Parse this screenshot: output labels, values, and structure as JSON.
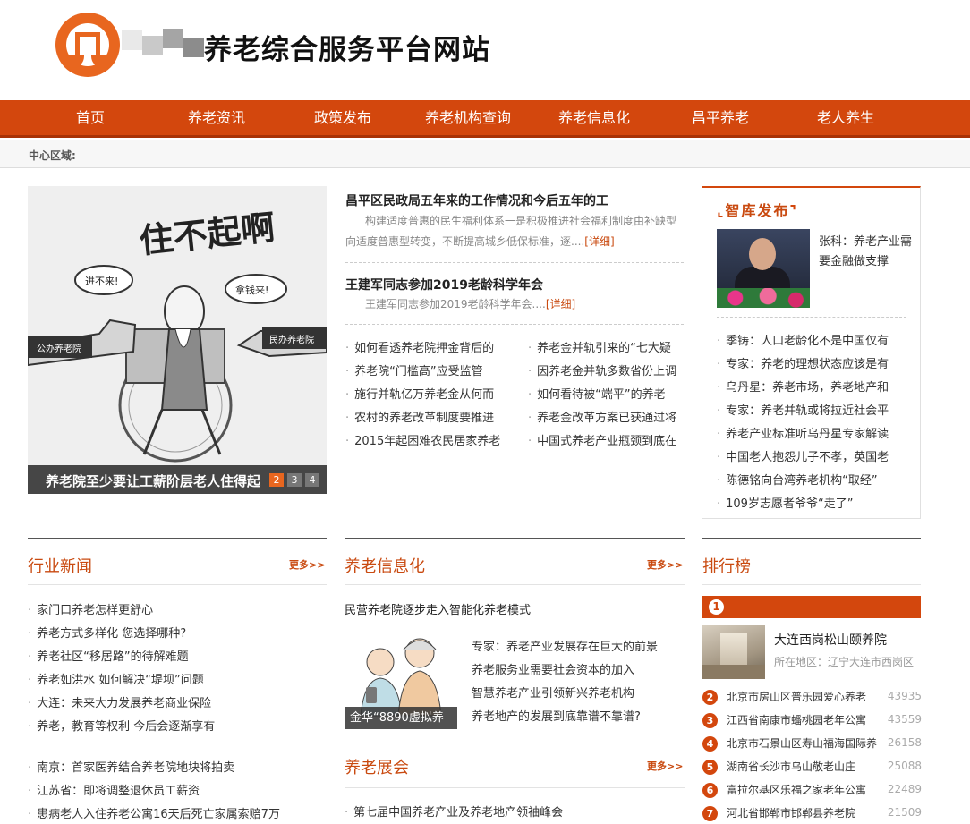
{
  "header": {
    "site_title": "养老综合服务平台网站"
  },
  "nav": [
    {
      "label": "首页"
    },
    {
      "label": "养老资讯"
    },
    {
      "label": "政策发布"
    },
    {
      "label": "养老机构查询"
    },
    {
      "label": "养老信息化"
    },
    {
      "label": "昌平养老"
    },
    {
      "label": "老人养生"
    }
  ],
  "center_label": "中心区域:",
  "slider": {
    "caption": "养老院至少要让工薪阶层老人住得起",
    "pages": [
      "2",
      "3",
      "4"
    ],
    "cartoon": {
      "title": "住不起啊",
      "left_bubble": "进不来!",
      "right_bubble": "拿钱来!",
      "left_sign": "公办养老院",
      "right_sign": "民办养老院"
    }
  },
  "top_news": [
    {
      "title": "昌平区民政局五年来的工作情况和今后五年的工",
      "summary": "构建适度普惠的民生福利体系一是积极推进社会福利制度由补缺型向适度普惠型转变，不断提高城乡低保标准，逐....",
      "more": "[详细]"
    },
    {
      "title": "王建军同志参加2019老龄科学年会",
      "summary": "王建军同志参加2019老龄科学年会....",
      "more": "[详细]"
    }
  ],
  "news_list_left": [
    "如何看透养老院押金背后的",
    "养老院“门槛高”应受监管",
    "施行并轨亿万养老金从何而",
    "农村的养老改革制度要推进",
    "2015年起困难农民居家养老"
  ],
  "news_list_right": [
    "养老金并轨引来的“七大疑",
    "因养老金并轨多数省份上调",
    "如何看待被“端平”的养老",
    "养老金改革方案已获通过将",
    "中国式养老产业瓶颈到底在"
  ],
  "think_tank": {
    "title": "智库发布",
    "feature": "张科：养老产业需要金融做支撑",
    "items": [
      "季铸：人口老龄化不是中国仅有",
      "专家：养老的理想状态应该是有",
      "乌丹星：养老市场，养老地产和",
      "专家：养老并轨或将拉近社会平",
      "养老产业标准听乌丹星专家解读",
      "中国老人抱怨儿子不孝，英国老",
      "陈德铭向台湾养老机构“取经”",
      "109岁志愿者爷爷“走了”"
    ]
  },
  "industry_news": {
    "title": "行业新闻",
    "more": "更多>>",
    "items": [
      "家门口养老怎样更舒心",
      "养老方式多样化 您选择哪种?",
      "养老社区“移居路”的待解难题",
      "养老如洪水 如何解决“堤坝”问题",
      "大连：未来大力发展养老商业保险",
      "养老，教育等权利 今后会逐渐享有"
    ],
    "items2": [
      "南京：首家医养结合养老院地块将拍卖",
      "江苏省：即将调整退休员工薪资",
      "患病老人入住养老公寓16天后死亡家属索赔7万"
    ]
  },
  "info_section": {
    "title": "养老信息化",
    "more": "更多>>",
    "headline": "民营养老院逐步走入智能化养老模式",
    "image_caption": "金华“8890虚拟养",
    "items": [
      "专家：养老产业发展存在巨大的前景",
      "养老服务业需要社会资本的加入",
      "智慧养老产业引领新兴养老机构",
      "养老地产的发展到底靠谱不靠谱?"
    ]
  },
  "expo_section": {
    "title": "养老展会",
    "more": "更多>>",
    "items": [
      "第七届中国养老产业及养老地产领袖峰会"
    ]
  },
  "ranking": {
    "title": "排行榜",
    "top": {
      "rank": "1",
      "name": "大连西岗松山颐养院",
      "area": "所在地区：辽宁大连市西岗区"
    },
    "items": [
      {
        "rank": "2",
        "name": "北京市房山区普乐园爱心养老",
        "count": "43935"
      },
      {
        "rank": "3",
        "name": "江西省南康市蟠桃园老年公寓",
        "count": "43559"
      },
      {
        "rank": "4",
        "name": "北京市石景山区寿山福海国际养",
        "count": "26158"
      },
      {
        "rank": "5",
        "name": "湖南省长沙市乌山敬老山庄",
        "count": "25088"
      },
      {
        "rank": "6",
        "name": "富拉尔基区乐福之家老年公寓",
        "count": "22489"
      },
      {
        "rank": "7",
        "name": "河北省邯郸市邯郸县养老院",
        "count": "21509"
      }
    ]
  },
  "colors": {
    "brand": "#d3470d",
    "accent_text": "#c94a10"
  }
}
